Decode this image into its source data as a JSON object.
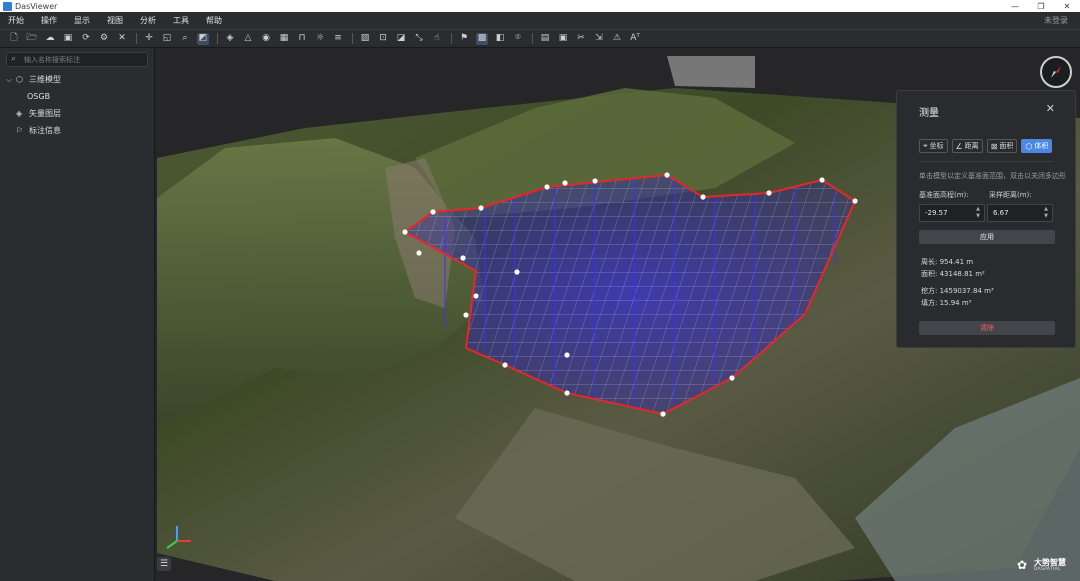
{
  "window": {
    "title": "DasViewer",
    "controls": [
      "—",
      "❐",
      "✕"
    ]
  },
  "menu": {
    "items": [
      "开始",
      "操作",
      "显示",
      "视图",
      "分析",
      "工具",
      "帮助"
    ],
    "login": "未登录"
  },
  "toolbar": {
    "groups": [
      [
        "new-file-icon",
        "open-folder-icon",
        "cloud-icon",
        "save-icon",
        "refresh-icon",
        "settings-icon",
        "close-icon"
      ],
      [
        "pan-icon",
        "select-icon",
        "zoom-icon",
        "measure-icon"
      ],
      [
        "layer-icon",
        "triangle-icon",
        "sphere-icon",
        "grid-icon",
        "bookmark-icon",
        "sun-icon",
        "sliders-icon"
      ],
      [
        "image-icon",
        "focus-icon",
        "crop-icon",
        "transform-icon",
        "hand-icon"
      ],
      [
        "flag-icon",
        "mesh-icon",
        "tile-icon",
        "pin-icon"
      ],
      [
        "doc-icon",
        "screen-icon",
        "cut-icon",
        "export-icon",
        "warning-icon",
        "text-icon"
      ]
    ]
  },
  "sidebar": {
    "search_placeholder": "输入名称搜索标注",
    "tree": [
      {
        "label": "三维模型",
        "icon": "cube-icon",
        "expanded": true,
        "level": 0
      },
      {
        "label": "OSGB",
        "icon": "",
        "level": 1
      },
      {
        "label": "矢量图层",
        "icon": "layers-icon",
        "level": 0
      },
      {
        "label": "标注信息",
        "icon": "flag-icon",
        "level": 0
      }
    ]
  },
  "measure_panel": {
    "title": "测量",
    "tabs": [
      {
        "label": "坐标",
        "icon": "coordinate-icon",
        "active": false
      },
      {
        "label": "距离",
        "icon": "ruler-icon",
        "active": false
      },
      {
        "label": "面积",
        "icon": "area-icon",
        "active": false
      },
      {
        "label": "体积",
        "icon": "volume-icon",
        "active": true
      }
    ],
    "hint": "单击模型以定义基准面范围，双击以关闭多边形",
    "base_height_label": "基准面高程(m):",
    "base_height_value": "-29.57",
    "sample_label": "采样距离(m):",
    "sample_value": "6.67",
    "apply_label": "应用",
    "perimeter": "周长: 954.41 m",
    "area": "面积: 43148.81 m²",
    "cut": "挖方: 1459037.84 m³",
    "fill": "填方: 15.94 m³",
    "clear_label": "清除"
  },
  "brand": {
    "cn": "大势智慧",
    "en": "DASPATIAL"
  },
  "colors": {
    "accent": "#4a87e6",
    "polygon": "#e8262a",
    "grid": "#5a4cff",
    "danger": "#ff5a5a"
  }
}
